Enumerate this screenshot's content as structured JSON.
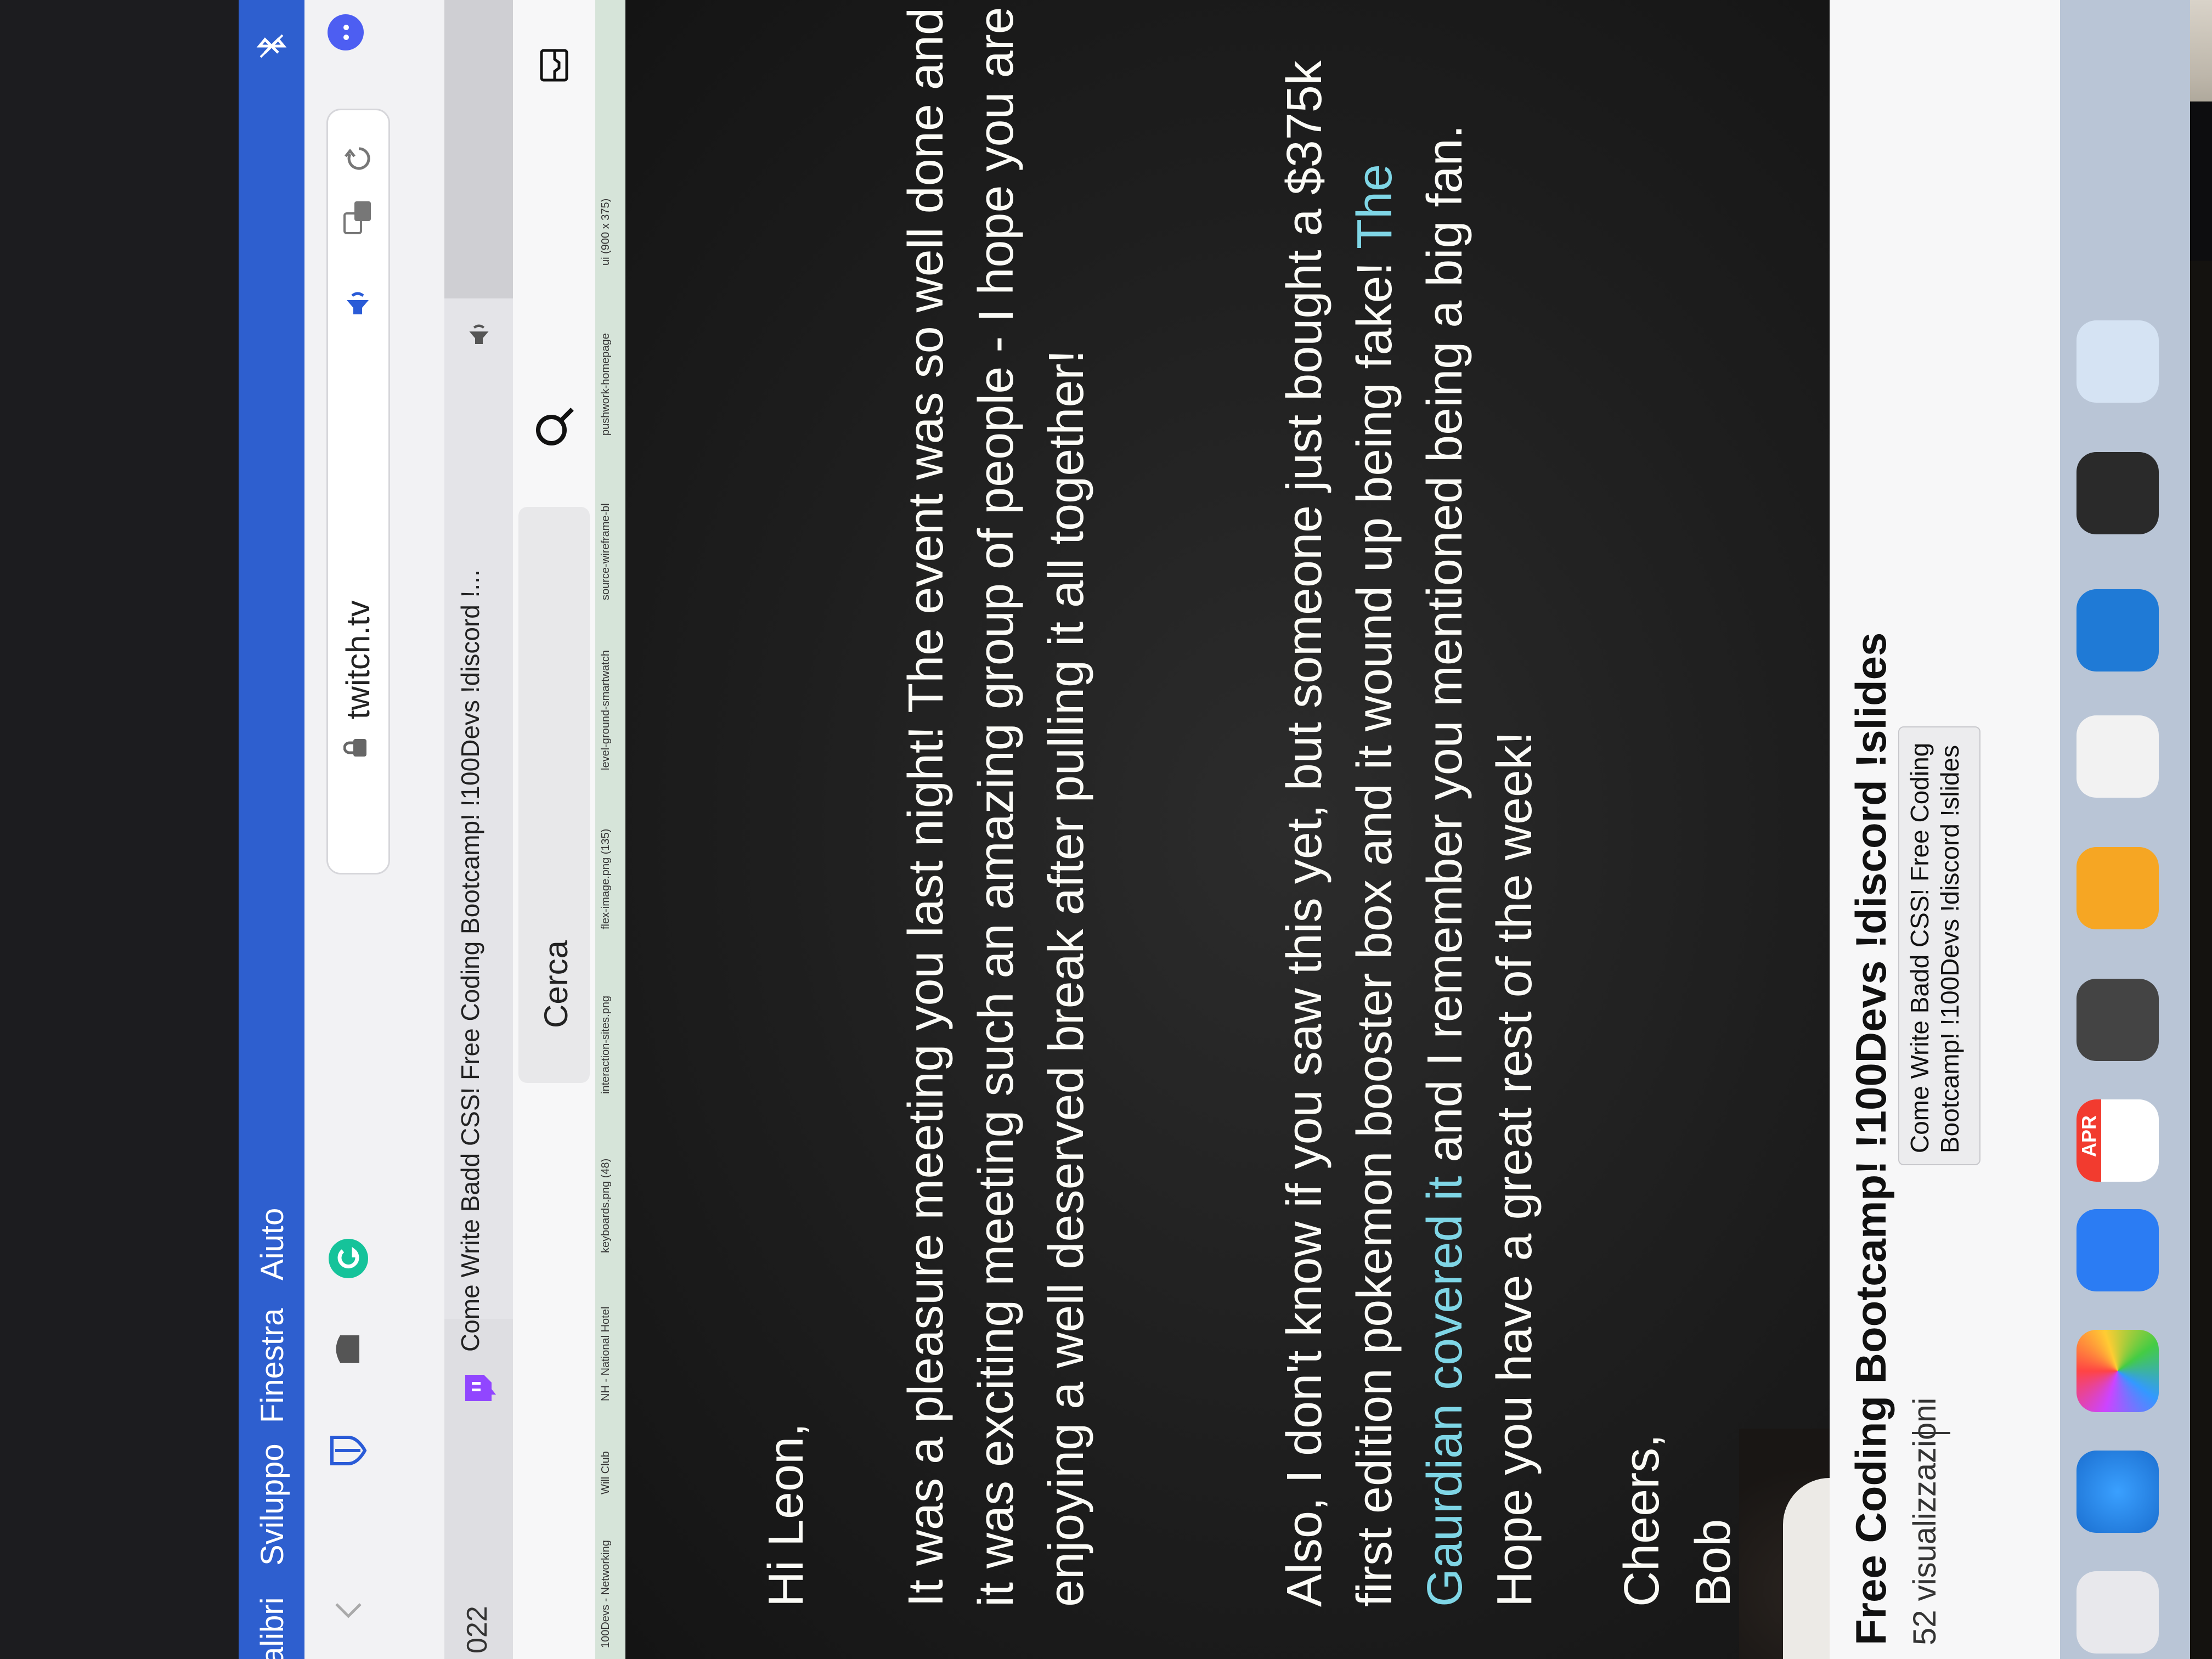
{
  "menubar": {
    "items": [
      "alibri",
      "Sviluppo",
      "Finestra",
      "Aiuto"
    ]
  },
  "browser": {
    "url": "twitch.tv",
    "tab_title": "Come Write Badd CSS! Free Coding Bootcamp! !100Devs !discord !...",
    "left_fragment": "022"
  },
  "twitch": {
    "search_placeholder": "Cerca"
  },
  "bookmarks": [
    "100Devs - Networking",
    "Will Club",
    "NH - National Hotel",
    "keyboards.png (48)",
    "interaction-sites.png",
    "flex-image.png (135)",
    "level-ground-smartwatch",
    "source-wireframe-bl",
    "pushwork-homepage",
    "ui (900 x 375)"
  ],
  "letter": {
    "greeting": "Hi Leon,",
    "paragraph1": "It was a pleasure meeting you last night! The event was so well done and it was exciting meeting such an amazing group of people - I hope you are enjoying a well deserved break after pulling it all together!",
    "paragraph2_before": "Also, I don't know if you saw this yet, but someone just bought a $375k first edition pokemon booster box and it wound up being fake! ",
    "paragraph2_link": "The Gaurdian covered it",
    "paragraph2_after": " and I remember you mentioned being a big fan. Hope you have a great rest of the week!",
    "signoff": "Cheers,",
    "signature": "Bob"
  },
  "stream": {
    "title": "Free Coding Bootcamp! !100Devs !discord !slides",
    "views": "52 visualizzazioni",
    "tooltip": "Come Write Badd CSS! Free Coding Bootcamp! !100Devs !discord !slides"
  },
  "dock": {
    "calendar_month": "APR"
  },
  "colors": {
    "menubar": "#2e5fcf",
    "link": "#7fd6e6",
    "twitch_purple": "#9146ff"
  }
}
